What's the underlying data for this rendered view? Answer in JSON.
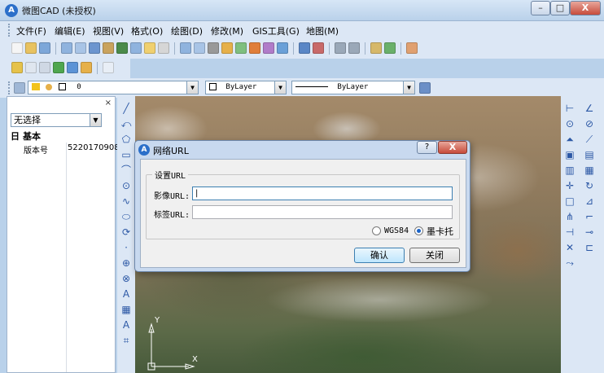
{
  "window": {
    "title": "微图CAD (未授权)",
    "logo": "A",
    "min": "–",
    "max": "□",
    "close": "X"
  },
  "menu": [
    "文件(F)",
    "编辑(E)",
    "视图(V)",
    "格式(O)",
    "绘图(D)",
    "修改(M)",
    "GIS工具(G)",
    "地图(M)"
  ],
  "layer": {
    "name": "0"
  },
  "props": {
    "color": "ByLayer",
    "linetype": "ByLayer"
  },
  "left_panel": {
    "close": "×",
    "select_value": "无选择",
    "group": "基本",
    "group_toggle": "日",
    "row_key": "版本号",
    "row_value": "5220170908"
  },
  "dialog": {
    "title": "网络URL",
    "help": "?",
    "close": "X",
    "logo": "A",
    "group_label": "设置URL",
    "image_url_label": "影像URL:",
    "image_url_value": "|",
    "tag_url_label": "标签URL:",
    "tag_url_value": "",
    "radio_wgs84": "WGS84",
    "radio_mercator": "墨卡托",
    "ok": "确认",
    "cancel": "关闭"
  },
  "icon_colors": [
    "#3b7dd8",
    "#e0a030",
    "#59a845",
    "#c8463e",
    "#7a5bb8"
  ],
  "vtools": [
    "╱",
    "⤺",
    "⬠",
    "▭",
    "⌒",
    "⊙",
    "∿",
    "⬭",
    "⟳",
    "·",
    "⊕",
    "⊗",
    "A",
    "▦",
    "A",
    "⌗"
  ],
  "rtools": [
    "⊢",
    "∠",
    "⊙",
    "⊘",
    "⏶",
    "⟋",
    "▣",
    "▤",
    "▥",
    "▦",
    "✛",
    "↻",
    "□",
    "⊿",
    "⋔",
    "⌐",
    "⊣",
    "⊸",
    "✕",
    "⊏",
    "⤳"
  ],
  "axis": {
    "x": "X",
    "y": "Y"
  }
}
